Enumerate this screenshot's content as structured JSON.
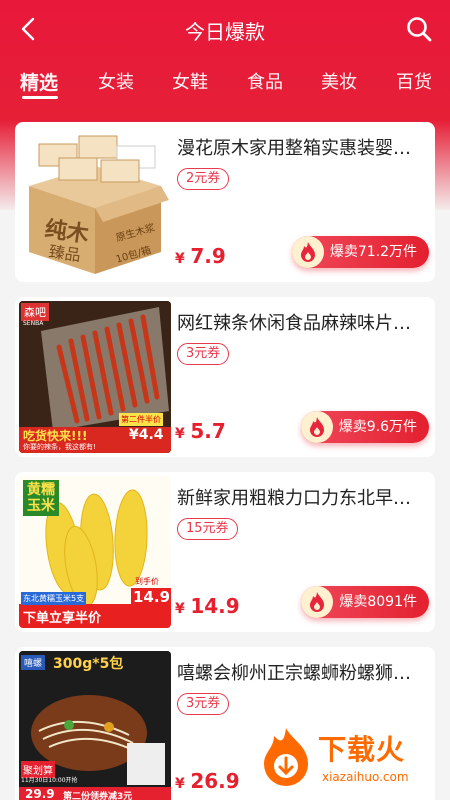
{
  "header": {
    "title": "今日爆款",
    "tabs": [
      "精选",
      "女装",
      "女鞋",
      "食品",
      "美妆",
      "百货"
    ],
    "active_tab": "精选"
  },
  "colors": {
    "brand_red": "#e5202f",
    "coupon_red": "#e83a4c",
    "watermark_orange": "#ff6a00"
  },
  "products": [
    {
      "title": "漫花原木家用整箱实惠装婴…",
      "coupon": "2元券",
      "currency": "¥",
      "price": "7.9",
      "sales": "爆卖71.2万件",
      "thumb_text": {
        "main": "纯木",
        "sub1": "臻品",
        "side": "原生木浆",
        "count": "10包/箱"
      }
    },
    {
      "title": "网红辣条休闲食品麻辣味片…",
      "coupon": "3元券",
      "currency": "¥",
      "price": "5.7",
      "sales": "爆卖9.6万件",
      "thumb_text": {
        "brand": "森吧",
        "brand_en": "SENBA",
        "slogan": "吃货快来!!!",
        "sub": "你要的辣条，我这都有!",
        "promo": "第二件半价",
        "promo_price": "¥4.4"
      }
    },
    {
      "title": "新鲜家用粗粮力口力东北早…",
      "coupon": "15元券",
      "currency": "¥",
      "price": "14.9",
      "sales": "爆卖8091件",
      "thumb_text": {
        "tag1": "黄糯",
        "tag2": "玉米",
        "label": "东北黄糯玉米5支",
        "banner": "下单立享半价",
        "promo": "到手价",
        "promo_price": "14.9"
      }
    },
    {
      "title": "嘻螺会柳州正宗螺蛳粉螺狮…",
      "coupon": "3元券",
      "currency": "¥",
      "price": "26.9",
      "sales": "",
      "thumb_text": {
        "brand": "嘻螺",
        "pack": "300g*5包",
        "event": "聚划算",
        "date": "11月30日10:00开抢",
        "promo_price": "29.9",
        "promo": "第二份领券减3元"
      }
    }
  ],
  "watermark": {
    "text": "下载火",
    "sub": "xiazaihuo.com"
  }
}
